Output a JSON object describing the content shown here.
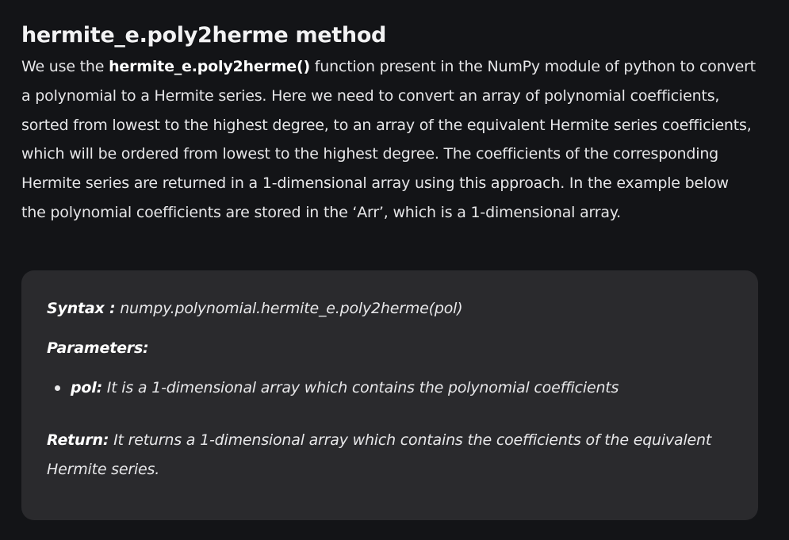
{
  "heading": "hermite_e.poly2herme method",
  "intro": {
    "prefix": "We use the ",
    "function_name": "hermite_e.poly2herme()",
    "suffix": " function present in the NumPy module of python to convert a polynomial to a Hermite series. Here we need to convert an array of polynomial coefficients, sorted from lowest to the highest degree, to an array of the equivalent Hermite series coefficients, which will be ordered from lowest to the highest degree. The coefficients of the corresponding Hermite series are returned in a 1-dimensional array using this approach. In the example below the polynomial coefficients are stored in the ‘Arr’, which is a 1-dimensional array."
  },
  "box": {
    "syntax_label": "Syntax :",
    "syntax_value": " numpy.polynomial.hermite_e.poly2herme(pol)",
    "parameters_label": "Parameters:",
    "params": [
      {
        "name": "pol:",
        "description": " It is a 1-dimensional array which contains the polynomial coefficients"
      }
    ],
    "return_label": "Return:",
    "return_value": " It returns a 1-dimensional array which contains the coefficients of the equivalent Hermite series."
  }
}
